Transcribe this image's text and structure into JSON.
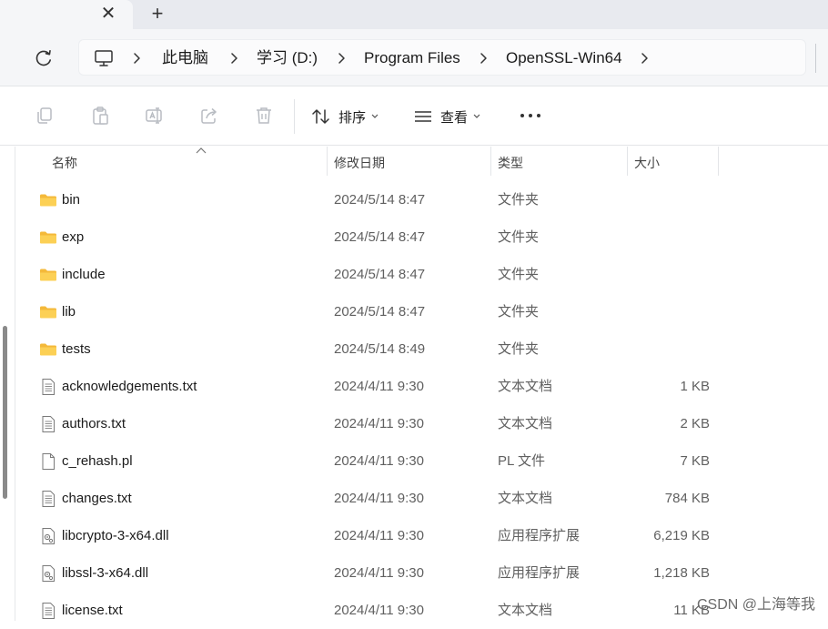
{
  "tabs": {
    "close_glyph": "✕",
    "new_glyph": "+"
  },
  "address": {
    "crumbs": [
      "此电脑",
      "学习 (D:)",
      "Program Files",
      "OpenSSL-Win64"
    ]
  },
  "toolbar": {
    "sort_label": "排序",
    "view_label": "查看"
  },
  "columns": {
    "name": "名称",
    "date": "修改日期",
    "type": "类型",
    "size": "大小"
  },
  "files": [
    {
      "name": "bin",
      "date": "2024/5/14 8:47",
      "type": "文件夹",
      "size": "",
      "icon": "folder-icon"
    },
    {
      "name": "exp",
      "date": "2024/5/14 8:47",
      "type": "文件夹",
      "size": "",
      "icon": "folder-icon"
    },
    {
      "name": "include",
      "date": "2024/5/14 8:47",
      "type": "文件夹",
      "size": "",
      "icon": "folder-icon"
    },
    {
      "name": "lib",
      "date": "2024/5/14 8:47",
      "type": "文件夹",
      "size": "",
      "icon": "folder-icon"
    },
    {
      "name": "tests",
      "date": "2024/5/14 8:49",
      "type": "文件夹",
      "size": "",
      "icon": "folder-icon"
    },
    {
      "name": "acknowledgements.txt",
      "date": "2024/4/11 9:30",
      "type": "文本文档",
      "size": "1 KB",
      "icon": "text-file-icon"
    },
    {
      "name": "authors.txt",
      "date": "2024/4/11 9:30",
      "type": "文本文档",
      "size": "2 KB",
      "icon": "text-file-icon"
    },
    {
      "name": "c_rehash.pl",
      "date": "2024/4/11 9:30",
      "type": "PL 文件",
      "size": "7 KB",
      "icon": "blank-file-icon"
    },
    {
      "name": "changes.txt",
      "date": "2024/4/11 9:30",
      "type": "文本文档",
      "size": "784 KB",
      "icon": "text-file-icon"
    },
    {
      "name": "libcrypto-3-x64.dll",
      "date": "2024/4/11 9:30",
      "type": "应用程序扩展",
      "size": "6,219 KB",
      "icon": "dll-file-icon"
    },
    {
      "name": "libssl-3-x64.dll",
      "date": "2024/4/11 9:30",
      "type": "应用程序扩展",
      "size": "1,218 KB",
      "icon": "dll-file-icon"
    },
    {
      "name": "license.txt",
      "date": "2024/4/11 9:30",
      "type": "文本文档",
      "size": "11 KB",
      "icon": "text-file-icon"
    }
  ],
  "watermark": "CSDN @上海等我",
  "colors": {
    "folder": "#f8c542",
    "accent": "#0067c0"
  }
}
